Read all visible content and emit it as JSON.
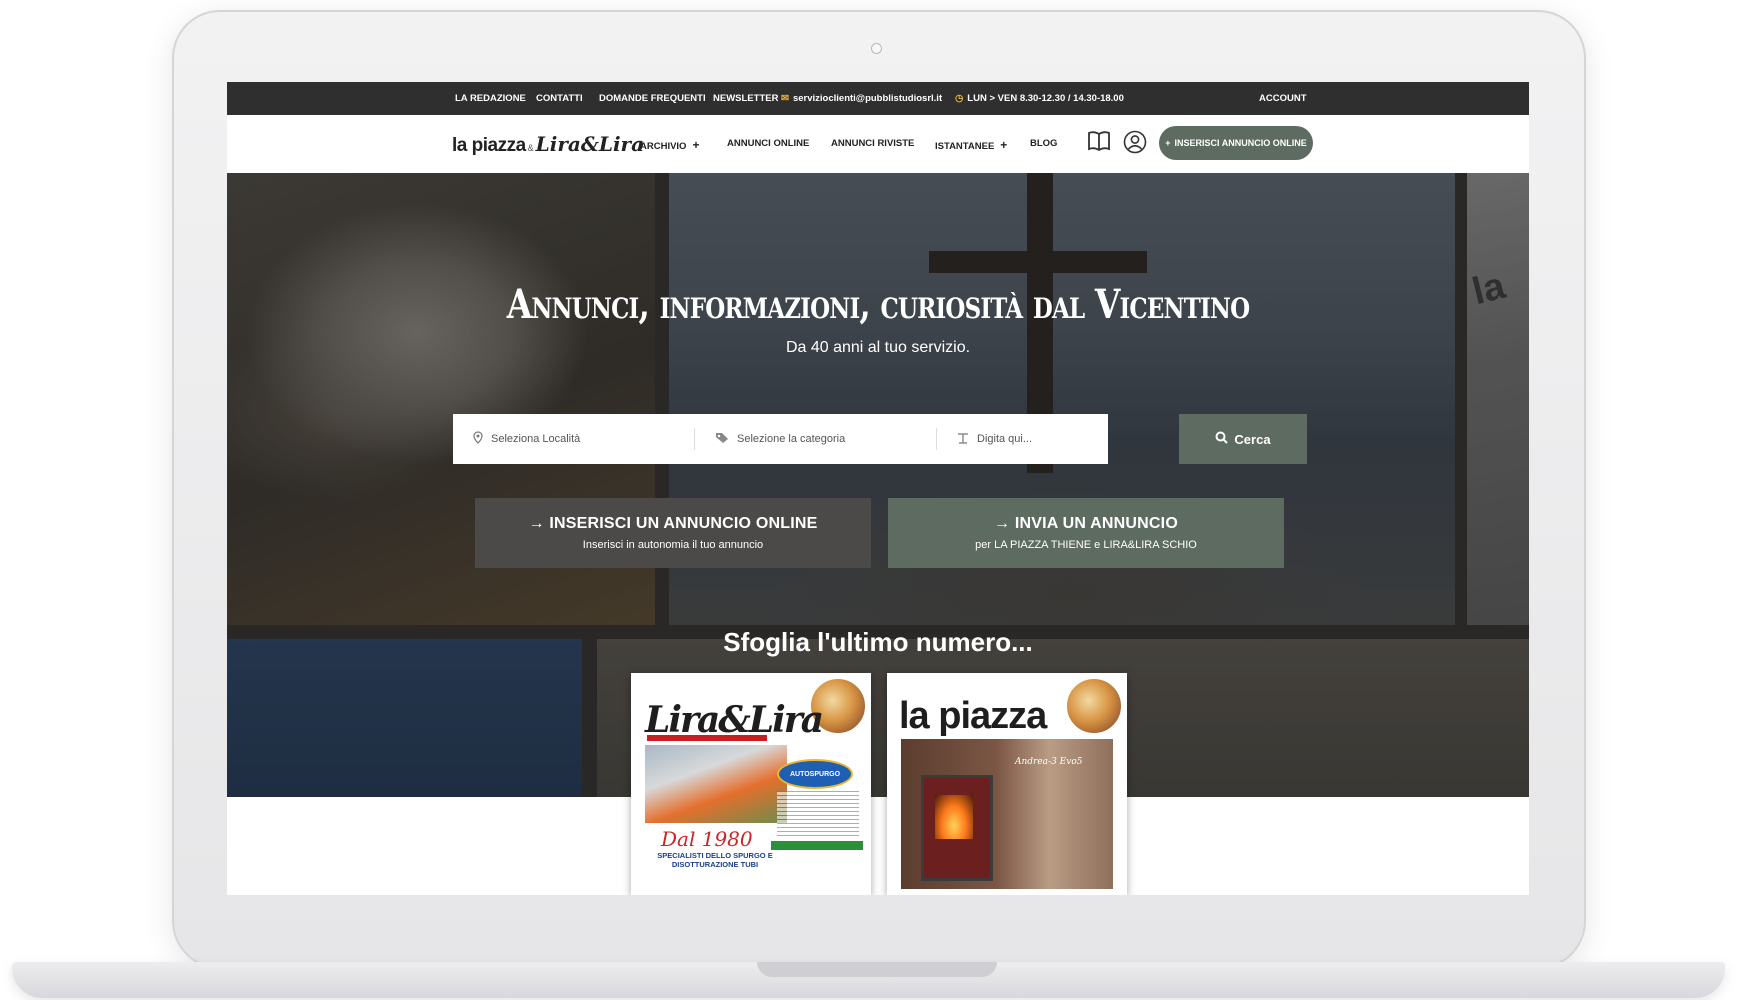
{
  "topbar": {
    "links": [
      "LA REDAZIONE",
      "CONTATTI",
      "DOMANDE FREQUENTI",
      "NEWSLETTER"
    ],
    "email": "servizioclienti@pubblistudiosrl.it",
    "hours": "LUN > VEN 8.30-12.30 / 14.30-18.00",
    "account": "ACCOUNT"
  },
  "nav": {
    "logo_main": "la piazza",
    "logo_amp": "&",
    "logo_secondary": "Lira&Lira",
    "items": [
      "ARCHIVIO",
      "ANNUNCI ONLINE",
      "ANNUNCI RIVISTE",
      "ISTANTANEE",
      "BLOG"
    ],
    "plus": "+",
    "cta": "INSERISCI ANNUNCIO ONLINE"
  },
  "hero": {
    "title": "Annunci, informazioni, curiosità dal Vicentino",
    "subtitle": "Da 40 anni al tuo servizio.",
    "bg_text": "la"
  },
  "search": {
    "location_placeholder": "Seleziona Località",
    "category_placeholder": "Selezione la categoria",
    "query_placeholder": "Digita qui...",
    "button": "Cerca"
  },
  "cta": {
    "left_title": "INSERISCI UN ANNUNCIO ONLINE",
    "left_sub": "Inserisci in autonomia il tuo annuncio",
    "right_title": "INVIA UN ANNUNCIO",
    "right_sub": "per LA PIAZZA THIENE e LIRA&LIRA SCHIO"
  },
  "latest": {
    "heading": "Sfoglia l'ultimo numero...",
    "cover_left": {
      "masthead": "Lira&Lira",
      "brand": "AUTOSPURGO",
      "since": "Dal 1980",
      "tagline": "SPECIALISTI DELLO SPURGO E DISOTTURAZIONE TUBI"
    },
    "cover_right": {
      "masthead": "la piazza",
      "ad_text": "Andrea-3 Evo5"
    }
  },
  "colors": {
    "topbar": "#2f2f2f",
    "accent": "#5e6b60",
    "cta_dark": "#4b4a48"
  }
}
